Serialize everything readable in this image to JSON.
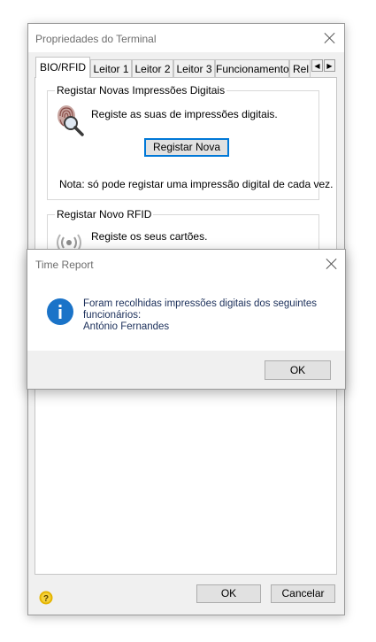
{
  "properties_window": {
    "title": "Propriedades do Terminal",
    "tabs": [
      "BIO/RFID",
      "Leitor 1",
      "Leitor 2",
      "Leitor 3",
      "Funcionamento",
      "Rel"
    ],
    "tab_scroll_left": "◀",
    "tab_scroll_right": "▶",
    "fingerprint_group": {
      "legend": "Registar Novas Impressões Digitais",
      "description": "Registe as suas de impressões digitais.",
      "register_button": "Registar Nova",
      "note": "Nota: só pode registar uma impressão digital de cada vez."
    },
    "rfid_group": {
      "legend": "Registar Novo RFID",
      "description": "Registe os seus cartões."
    },
    "ok_button": "OK",
    "cancel_button": "Cancelar"
  },
  "dialog": {
    "title": "Time Report",
    "message_line1": "Foram recolhidas impressões digitais dos seguintes",
    "message_line2": "funcionários:",
    "message_line3": "António Fernandes",
    "ok_button": "OK"
  },
  "colors": {
    "accent": "#0078d7",
    "info_icon": "#1a73c8",
    "window_bg": "#f0f0f0"
  },
  "icons": [
    "close-icon",
    "fingerprint-icon",
    "rfid-icon",
    "info-icon",
    "help-icon"
  ]
}
